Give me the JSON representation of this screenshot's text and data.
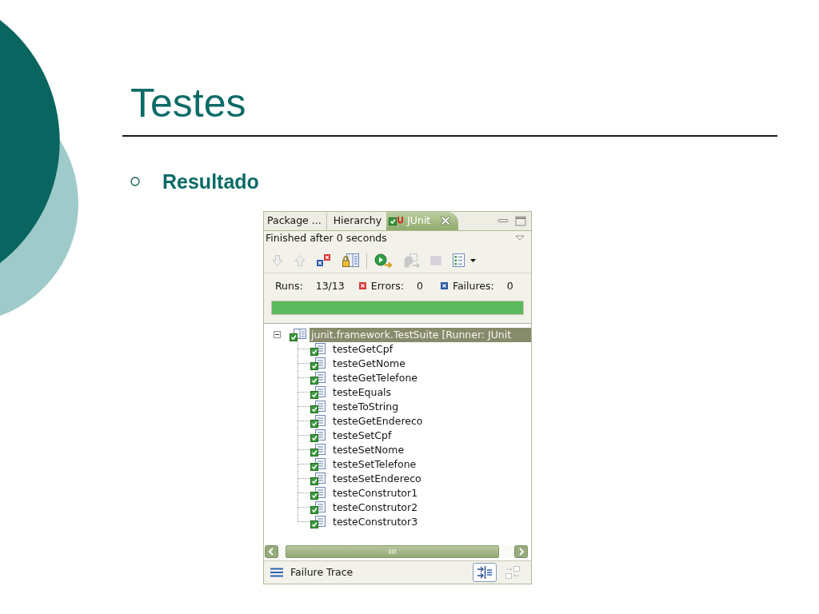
{
  "slide": {
    "title": "Testes",
    "bullets": [
      {
        "text": "Resultado"
      }
    ]
  },
  "junit_view": {
    "tabs": [
      {
        "label": "Package ...",
        "selected": false
      },
      {
        "label": "Hierarchy",
        "selected": false
      },
      {
        "label": "JUnit",
        "selected": true
      }
    ],
    "status": "Finished after 0 seconds",
    "toolbar_groups": [
      {
        "items": [
          {
            "kind": "next",
            "disabled": true,
            "dropdown": false
          },
          {
            "kind": "previous",
            "disabled": true,
            "dropdown": false
          },
          {
            "kind": "failuresonly",
            "disabled": false,
            "dropdown": false
          },
          {
            "kind": "scrolllock",
            "disabled": false,
            "dropdown": false
          }
        ]
      },
      {
        "items": [
          {
            "kind": "rerun",
            "disabled": false,
            "dropdown": false
          },
          {
            "kind": "rerunfailed",
            "disabled": true,
            "dropdown": false
          },
          {
            "kind": "stop",
            "disabled": true,
            "dropdown": false
          },
          {
            "kind": "history",
            "disabled": false,
            "dropdown": true
          }
        ]
      }
    ],
    "counters": [
      {
        "kind": "runs",
        "label": "Runs:",
        "value": "13/13"
      },
      {
        "kind": "errors",
        "label": "Errors:",
        "value": "0"
      },
      {
        "kind": "failures",
        "label": "Failures:",
        "value": "0"
      }
    ],
    "progress": {
      "level": 1,
      "failed": false
    },
    "tree": [
      {
        "label": "junit.framework.TestSuite [Runner: JUnit",
        "expanded": true,
        "selected": true,
        "passed": true,
        "children": [
          {
            "label": "testeGetCpf",
            "selected": false,
            "passed": true
          },
          {
            "label": "testeGetNome",
            "selected": false,
            "passed": true
          },
          {
            "label": "testeGetTelefone",
            "selected": false,
            "passed": true
          },
          {
            "label": "testeEquals",
            "selected": false,
            "passed": true
          },
          {
            "label": "testeToString",
            "selected": false,
            "passed": true
          },
          {
            "label": "testeGetEndereco",
            "selected": false,
            "passed": true
          },
          {
            "label": "testeSetCpf",
            "selected": false,
            "passed": true
          },
          {
            "label": "testeSetNome",
            "selected": false,
            "passed": true
          },
          {
            "label": "testeSetTelefone",
            "selected": false,
            "passed": true
          },
          {
            "label": "testeSetEndereco",
            "selected": false,
            "passed": true
          },
          {
            "label": "testeConstrutor1",
            "selected": false,
            "passed": true
          },
          {
            "label": "testeConstrutor2",
            "selected": false,
            "passed": true
          },
          {
            "label": "testeConstrutor3",
            "selected": false,
            "passed": true
          }
        ]
      }
    ],
    "failure_trace": {
      "title": "Failure Trace",
      "buttons": [
        {
          "kind": "filter",
          "pressed": true,
          "disabled": false
        },
        {
          "kind": "compare",
          "pressed": false,
          "disabled": true
        }
      ]
    }
  }
}
